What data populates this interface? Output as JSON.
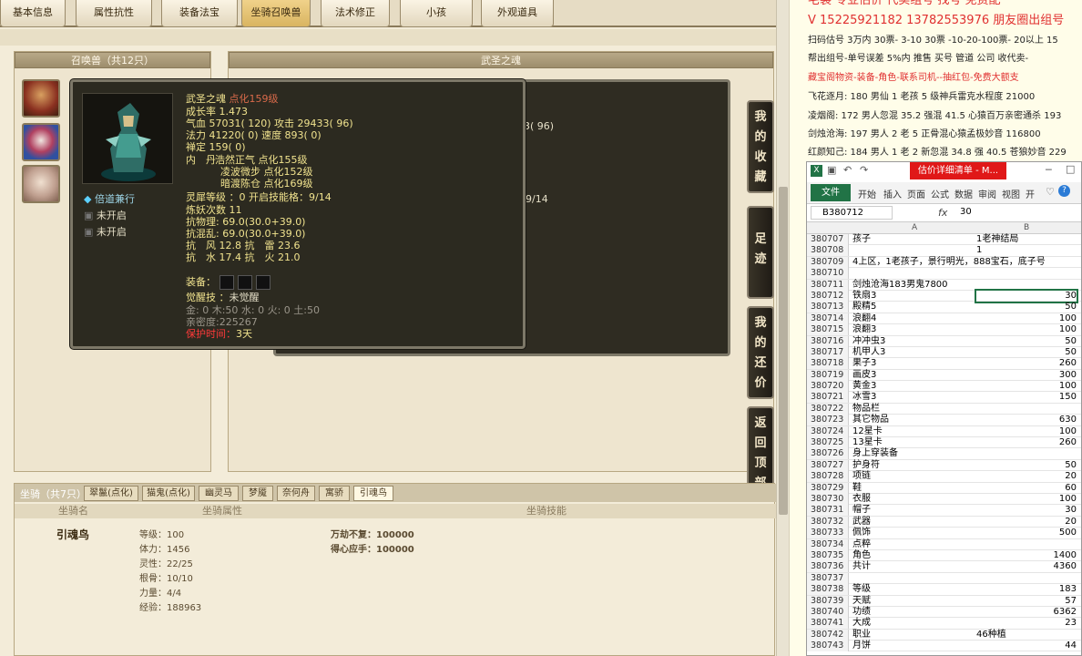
{
  "tabs": [
    {
      "label": "基本信息"
    },
    {
      "label": "属性抗性"
    },
    {
      "label": "装备法宝"
    },
    {
      "label": "坐骑召唤兽"
    },
    {
      "label": "法术修正"
    },
    {
      "label": "小孩"
    },
    {
      "label": "外观道具"
    }
  ],
  "summon_panel": {
    "title": "召唤兽（共12只）"
  },
  "detail_panel": {
    "title": "武圣之魂"
  },
  "tooltip": {
    "name": "武圣之魂",
    "name_tag": "点化159级",
    "growth": "成长率 1.473",
    "hp": "气血 57031( 120) 攻击 29433( 96)",
    "mp": "法力 41220( 0) 速度 893( 0)",
    "ding": "禅定 159( 0)",
    "neidan_label": "内　丹",
    "neidan1": "浩然正气 点化155级",
    "neidan2": "凌波微步 点化152级",
    "neidan3": "暗渡陈仓 点化169级",
    "skill1": "倍道兼行",
    "skill2": "未开启",
    "skill3": "未开启",
    "lingxi": "灵犀等级 ：0 开启技能格：9/14",
    "lianyao": "炼妖次数 11",
    "kang1": "抗物理: 69.0(30.0+39.0)",
    "kang2": "抗混乱: 69.0(30.0+39.0)",
    "kang3": "抗　风 12.8 抗　雷 23.6",
    "kang4": "抗　水 17.4 抗　火 21.0",
    "equip_label": "装备：",
    "awaken_label": "觉醒技 ：",
    "awaken_value": "未觉醒",
    "wuxing": "金: 0 木:50 水: 0 火: 0 土:50",
    "intimacy": "亲密度:225267",
    "protect_label": "保护时间：",
    "protect_value": "3天"
  },
  "tooltip2": {
    "v1": "3( 96)",
    "v2": "9/14"
  },
  "side_buttons": [
    {
      "label": "我的收藏",
      "chars": [
        "我",
        "的",
        "收",
        "藏"
      ]
    },
    {
      "label": "足迹",
      "chars": [
        "足",
        "迹"
      ]
    },
    {
      "label": "我的还价",
      "chars": [
        "我",
        "的",
        "还",
        "价"
      ]
    },
    {
      "label": "返回顶部",
      "chars": [
        "返",
        "回",
        "顶",
        "部"
      ]
    }
  ],
  "mount": {
    "title": "坐骑（共7只）",
    "tabs": [
      "翠鬣(点化)",
      "猫鬼(点化)",
      "幽灵马",
      "梦魇",
      "奈何舟",
      "寓骄",
      "引魂鸟"
    ],
    "col1": "坐骑名",
    "col2": "坐骑属性",
    "col3": "坐骑技能",
    "name": "引魂鸟",
    "attrs": [
      "等级：100",
      "体力：1456",
      "灵性：22/25",
      "根骨：10/10",
      "力量：4/4",
      "经验：188963"
    ],
    "skills": [
      "万劫不复：100000",
      "得心应手：100000"
    ]
  },
  "doc": {
    "line0": "宅装 专业估价 代卖组号 找号 免费配",
    "line1": "V 15225921182  13782553976 朋友圈出组号",
    "line2": "扫码估号 3万内 30票- 3-10 30票 -10-20-100票- 20以上 15",
    "line3": "帮出组号-单号误差 5%内 推售 买号 管道 公司 收代卖-",
    "line4": "藏宝阁物资-装备-角色-联系司机--抽红包-免费大额支",
    "line5": "飞花逐月: 180 男仙 1 老孩 5 级神兵雷克水程度 21000",
    "line6": "凌烟阁: 172 男人忽混 35.2 强混 41.5 心猿百万亲密通杀 193",
    "line7": "剑烛沧海: 197 男人 2 老 5 正骨混心猿孟极妙音 116800",
    "line8": "红颜知己: 184 男人 1 老 2 新忽混 34.8 强 40.5 苍狼妙音 229"
  },
  "excel": {
    "title": "估价详细清单 - M...",
    "ribbon": [
      "文件",
      "开始",
      "插入",
      "页面",
      "公式",
      "数据",
      "审阅",
      "视图",
      "开"
    ],
    "namebox": "B380712",
    "fx": "fx",
    "formula": "30",
    "colA": "A",
    "colB": "B",
    "rows": [
      {
        "n": "380707",
        "a": "孩子",
        "b": "1老神结局",
        "bl": true
      },
      {
        "n": "380708",
        "a": "",
        "b": "1",
        "bl": true
      },
      {
        "n": "380709",
        "a": "4上区，1老孩子，景行明光，888宝石，底子号",
        "b": "",
        "bl": true
      },
      {
        "n": "380710",
        "a": "",
        "b": ""
      },
      {
        "n": "380711",
        "a": "剑烛沧海183男鬼7800",
        "b": ""
      },
      {
        "n": "380712",
        "a": "铁扇3",
        "b": "30"
      },
      {
        "n": "380713",
        "a": "殿精5",
        "b": "50"
      },
      {
        "n": "380714",
        "a": "浪翻4",
        "b": "100"
      },
      {
        "n": "380715",
        "a": "浪翻3",
        "b": "100"
      },
      {
        "n": "380716",
        "a": "冲冲虫3",
        "b": "50"
      },
      {
        "n": "380717",
        "a": "机甲人3",
        "b": "50"
      },
      {
        "n": "380718",
        "a": "果子3",
        "b": "260"
      },
      {
        "n": "380719",
        "a": "画皮3",
        "b": "300"
      },
      {
        "n": "380720",
        "a": "黄金3",
        "b": "100"
      },
      {
        "n": "380721",
        "a": "冰雪3",
        "b": "150"
      },
      {
        "n": "380722",
        "a": "物品栏",
        "b": ""
      },
      {
        "n": "380723",
        "a": "其它物品",
        "b": "630"
      },
      {
        "n": "380724",
        "a": "12星卡",
        "b": "100"
      },
      {
        "n": "380725",
        "a": "13星卡",
        "b": "260"
      },
      {
        "n": "380726",
        "a": "身上穿装备",
        "b": ""
      },
      {
        "n": "380727",
        "a": "护身符",
        "b": "50"
      },
      {
        "n": "380728",
        "a": "项链",
        "b": "20"
      },
      {
        "n": "380729",
        "a": "鞋",
        "b": "60"
      },
      {
        "n": "380730",
        "a": "衣服",
        "b": "100"
      },
      {
        "n": "380731",
        "a": "帽子",
        "b": "30"
      },
      {
        "n": "380732",
        "a": "武器",
        "b": "20"
      },
      {
        "n": "380733",
        "a": "佩饰",
        "b": "500"
      },
      {
        "n": "380734",
        "a": "点粹",
        "b": ""
      },
      {
        "n": "380735",
        "a": "角色",
        "b": "1400"
      },
      {
        "n": "380736",
        "a": "共计",
        "b": "4360"
      },
      {
        "n": "380737",
        "a": "",
        "b": ""
      },
      {
        "n": "380738",
        "a": "等级",
        "b": "183"
      },
      {
        "n": "380739",
        "a": "天赋",
        "b": "57"
      },
      {
        "n": "380740",
        "a": "功绩",
        "b": "6362"
      },
      {
        "n": "380741",
        "a": "大成",
        "b": "23"
      },
      {
        "n": "380742",
        "a": "职业",
        "b": "46种植",
        "bl": true
      },
      {
        "n": "380743",
        "a": "月饼",
        "b": "44"
      }
    ]
  }
}
